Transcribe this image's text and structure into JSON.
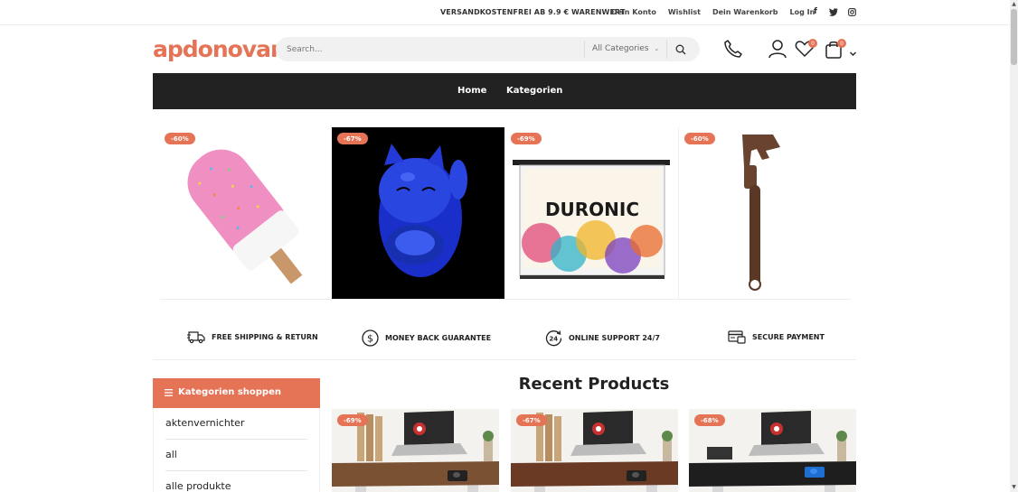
{
  "topbar": {
    "promo": "VERSANDKOSTENFREI AB 9.9 € WARENWERT",
    "links": [
      "Dein Konto",
      "Wishlist",
      "Dein Warenkorb",
      "Log In"
    ],
    "social_icons": [
      "facebook-icon",
      "twitter-icon",
      "instagram-icon"
    ]
  },
  "header": {
    "logo": "apdonovan",
    "search_placeholder": "Search...",
    "category_select": "All Categories",
    "wishlist_count": "0",
    "cart_count": "0"
  },
  "nav": {
    "items": [
      "Home",
      "Kategorien"
    ]
  },
  "tiles": [
    {
      "discount": "-60%",
      "image": "popsicle-pillow"
    },
    {
      "discount": "-67%",
      "image": "blue-lucky-cat"
    },
    {
      "discount": "-69%",
      "image": "projector-screen"
    },
    {
      "discount": "-60%",
      "image": "pipe-wrench"
    }
  ],
  "screen_logo": "DURONIC",
  "features": [
    {
      "icon": "truck-icon",
      "label": "FREE SHIPPING & RETURN"
    },
    {
      "icon": "dollar-icon",
      "label": "MONEY BACK GUARANTEE"
    },
    {
      "icon": "support-24-icon",
      "label": "ONLINE SUPPORT 24/7"
    },
    {
      "icon": "payment-icon",
      "label": "SECURE PAYMENT"
    }
  ],
  "sidebar": {
    "title": "Kategorien shoppen",
    "items": [
      "aktenvernichter",
      "all",
      "alle produkte"
    ]
  },
  "recent": {
    "title": "Recent Products",
    "products": [
      {
        "discount": "-69%",
        "desk_color": "#7a5233"
      },
      {
        "discount": "-67%",
        "desk_color": "#6b3a24"
      },
      {
        "discount": "-68%",
        "desk_color": "#1e1e1e"
      }
    ]
  },
  "colors": {
    "accent": "#e57356",
    "nav_bg": "#222222"
  }
}
